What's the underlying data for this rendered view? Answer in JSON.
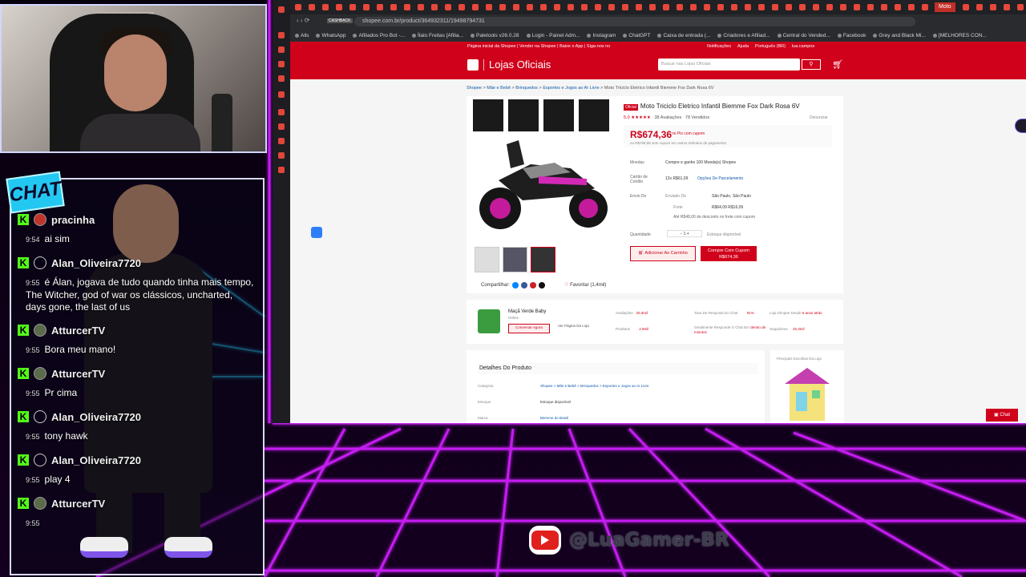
{
  "chat": {
    "logo": "CHAT",
    "messages": [
      {
        "user": "pracinha",
        "time": "9:54",
        "text": "ai sim"
      },
      {
        "user": "Alan_Oliveira7720",
        "time": "9:55",
        "text": "é Álan, jogava de tudo quando tinha mais tempo, The Witcher, god of war os clássicos, uncharted, days gone, the last of us"
      },
      {
        "user": "AtturcerTV",
        "time": "9:55",
        "text": "Bora meu mano!"
      },
      {
        "user": "AtturcerTV",
        "time": "9:55",
        "text": "Pr cima"
      },
      {
        "user": "Alan_Oliveira7720",
        "time": "9:55",
        "text": "tony hawk"
      },
      {
        "user": "Alan_Oliveira7720",
        "time": "9:55",
        "text": "play 4"
      },
      {
        "user": "AtturcerTV",
        "time": "9:55",
        "text": ""
      }
    ]
  },
  "browser": {
    "active_tab": "Moto",
    "url": "shopee.com.br/product/364932311/19498794731",
    "cashback": "CASHBACK",
    "bookmarks": [
      "Alls",
      "WhatsApp",
      "Afiliados Pro Bot -...",
      "Ítalo Freitas [Afilia...",
      "Paletools v26.0.28",
      "Login - Painel Adm...",
      "Instagram",
      "ChatGPT",
      "Caixa de entrada (...",
      "Criadores e Afiliad...",
      "Central do Vended...",
      "Facebook",
      "Grey and Black Mi...",
      "[MELHORES CON..."
    ]
  },
  "shopee": {
    "top_links": "Página inicial da Shopee  |  Vender na Shopee  |  Baixe o App  |  Siga-nos no",
    "right_links": [
      "Notificações",
      "Ajuda",
      "Português (BR)",
      "lua.campos"
    ],
    "logo": "Lojas Oficiais",
    "search_placeholder": "Buscar nas Lojas Oficiais",
    "breadcrumb": [
      "Shopee",
      "Mãe e Bebê",
      "Brinquedos",
      "Esportes e Jogos ao Ar Livre",
      "Moto Triciclo Eletrico Infantil Biemme Fox Dark Rosa 6V"
    ],
    "product": {
      "badge": "Oficial",
      "title": "Moto Triciclo Eletrico Infantil Biemme Fox Dark Rosa 6V",
      "rating": "5.0",
      "reviews": "38",
      "reviews_label": "Avaliações",
      "sold": "78",
      "sold_label": "Vendidos",
      "report": "Denunciar",
      "price": "R$674,36",
      "price_note": "no Pix com cupom",
      "price_sub": "ou R$758,08 sem cupom em outros métodos de pagamento",
      "coins_label": "Moedas",
      "coins_value": "Compre e ganhe 100 Moeda(s) Shopee",
      "card_label": "Cartão de Crédito",
      "card_value": "12x R$61,09",
      "card_link": "Opções De Parcelamento",
      "ship_label": "Envio De",
      "ship_from": "Enviado De",
      "ship_city": "São Paulo, São Paulo",
      "freight_label": "Frete",
      "freight_value": "R$64,09  R$16,09",
      "freight_note": "Até R$48,00 de desconto no frete com cupom",
      "qty_label": "Quantidade",
      "qty": "1",
      "stock": "Estoque disponível",
      "add_cart": "Adicionar Ao Carrinho",
      "buy_line1": "Compre Com Cupom",
      "buy_line2": "R$674,36",
      "share": "Compartilhar:",
      "favorite": "Favoritar (1,4mil)"
    },
    "shop": {
      "name": "Maçã Verde Baby",
      "online": "Online",
      "chat": "Conversar Agora",
      "view": "Ver Página Da Loja",
      "stats": [
        {
          "label": "Avaliações",
          "value": "20,3mil"
        },
        {
          "label": "Taxa De Resposta Do Chat",
          "value": "91%"
        },
        {
          "label": "Loja Shopee Desde",
          "value": "6 anos atrás"
        },
        {
          "label": "Produtos",
          "value": "2,9mil"
        },
        {
          "label": "Geralmente Responde O Chat Em",
          "value": "dentro de minutos"
        },
        {
          "label": "Seguidores",
          "value": "45,3mil"
        }
      ]
    },
    "details": {
      "title": "Detalhes Do Produto",
      "category_label": "Categoria",
      "category_value": "Shopee > Mãe e Bebê > Brinquedos > Esportes e Jogos ao Ar Livre",
      "stock_label": "Estoque",
      "stock_value": "Estoque disponível",
      "brand_label": "Marca",
      "brand_value": "Biemme do Brasil"
    },
    "side_title": "Principais Escolhas Da Loja",
    "chat_button": "Chat"
  },
  "overlay": {
    "channel": "@LuaGamer-BR"
  }
}
